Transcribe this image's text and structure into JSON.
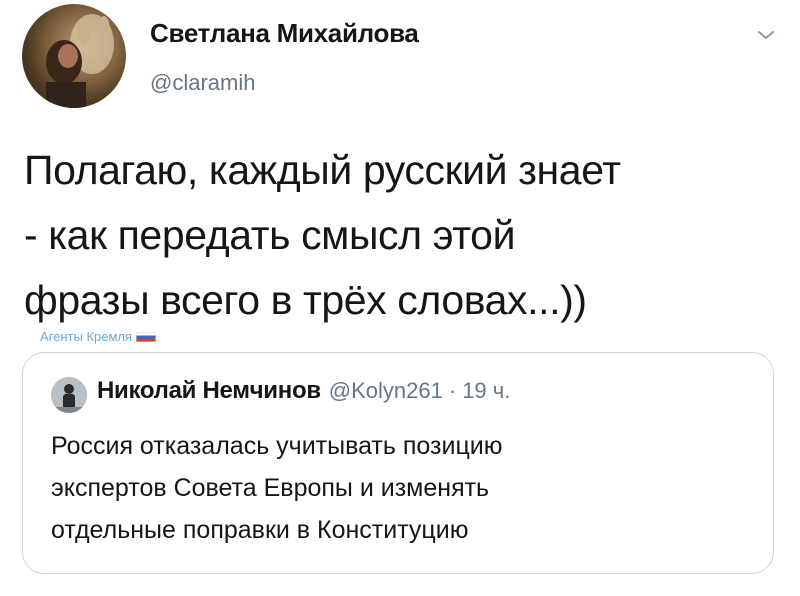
{
  "tweet": {
    "author": {
      "name": "Светлана Михайлова",
      "handle": "@claramih",
      "avatar_icon": "profile-photo-with-dog"
    },
    "menu_icon": "chevron-down-icon",
    "text": "Полагаю, каждый русский знает\n- как передать смысл этой\nфразы всего в трёх словах...))",
    "watermark": "Агенты Кремля",
    "watermark_flag_colors": [
      "#ffffff",
      "#1f5cc6",
      "#d52b1e"
    ],
    "quoted_tweet": {
      "author_name": "Николай Немчинов",
      "author_handle": "@Kolyn261",
      "separator": "·",
      "time": "19 ч.",
      "text": "Россия отказалась учитывать позицию\nэкспертов Совета Европы и изменять\nотдельные поправки в Конституцию"
    }
  },
  "colors": {
    "text_primary": "#14171a",
    "text_secondary": "#657786",
    "border": "#ccd6dd",
    "watermark": "#5a9fd6"
  }
}
